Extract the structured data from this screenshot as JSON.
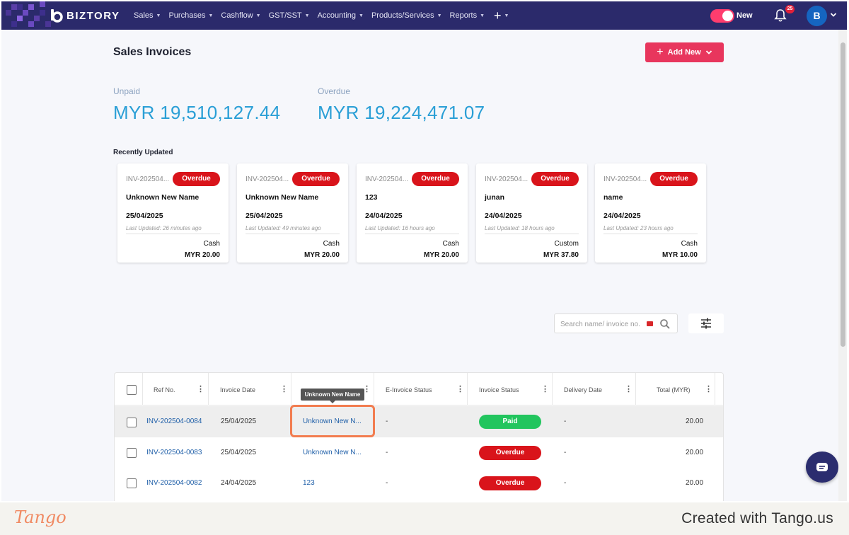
{
  "nav": {
    "brand": "BIZTORY",
    "menu": [
      {
        "label": "Sales"
      },
      {
        "label": "Purchases"
      },
      {
        "label": "Cashflow"
      },
      {
        "label": "GST/SST"
      },
      {
        "label": "Accounting"
      },
      {
        "label": "Products/Services"
      },
      {
        "label": "Reports"
      }
    ],
    "toggle_label": "New",
    "notification_count": "25",
    "avatar_initial": "B",
    "accent_color": "#ff3d6e",
    "nav_bg": "#2b2a6b"
  },
  "page": {
    "title": "Sales Invoices",
    "add_new_label": "Add New"
  },
  "summary": {
    "unpaid_label": "Unpaid",
    "unpaid_value": "MYR 19,510,127.44",
    "overdue_label": "Overdue",
    "overdue_value": "MYR 19,224,471.07"
  },
  "recent": {
    "title": "Recently Updated",
    "cards": [
      {
        "ref": "INV-202504...",
        "status": "Overdue",
        "name": "Unknown New Name",
        "date": "25/04/2025",
        "updated": "Last Updated: 26 minutes ago",
        "method": "Cash",
        "amount": "MYR 20.00"
      },
      {
        "ref": "INV-202504...",
        "status": "Overdue",
        "name": "Unknown New Name",
        "date": "25/04/2025",
        "updated": "Last Updated: 49 minutes ago",
        "method": "Cash",
        "amount": "MYR 20.00"
      },
      {
        "ref": "INV-202504...",
        "status": "Overdue",
        "name": "123",
        "date": "24/04/2025",
        "updated": "Last Updated: 16 hours ago",
        "method": "Cash",
        "amount": "MYR 20.00"
      },
      {
        "ref": "INV-202504...",
        "status": "Overdue",
        "name": "junan",
        "date": "24/04/2025",
        "updated": "Last Updated: 18 hours ago",
        "method": "Custom",
        "amount": "MYR 37.80"
      },
      {
        "ref": "INV-202504...",
        "status": "Overdue",
        "name": "name",
        "date": "24/04/2025",
        "updated": "Last Updated: 23 hours ago",
        "method": "Cash",
        "amount": "MYR 10.00"
      }
    ]
  },
  "search": {
    "placeholder": "Search name/ invoice no."
  },
  "table": {
    "columns": [
      "Ref No.",
      "Invoice Date",
      "",
      "E-Invoice Status",
      "Invoice Status",
      "Delivery Date",
      "Total (MYR)"
    ],
    "tooltip": "Unknown New Name",
    "rows": [
      {
        "ref": "INV-202504-0084",
        "date": "25/04/2025",
        "name": "Unknown New N...",
        "einvoice": "-",
        "status": "Paid",
        "delivery": "-",
        "total": "20.00"
      },
      {
        "ref": "INV-202504-0083",
        "date": "25/04/2025",
        "name": "Unknown New N...",
        "einvoice": "-",
        "status": "Overdue",
        "delivery": "-",
        "total": "20.00"
      },
      {
        "ref": "INV-202504-0082",
        "date": "24/04/2025",
        "name": "123",
        "einvoice": "-",
        "status": "Overdue",
        "delivery": "-",
        "total": "20.00"
      }
    ]
  },
  "footer": {
    "logo": "Tango",
    "created": "Created with Tango.us"
  }
}
